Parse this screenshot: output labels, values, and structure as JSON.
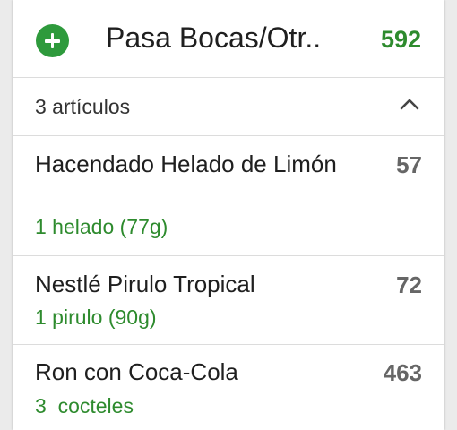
{
  "meal": {
    "title": "Pasa Bocas/Otr..",
    "total_calories": "592",
    "item_count_label": "3 artículos"
  },
  "items": [
    {
      "name": "Hacendado Helado de Limón",
      "serving": "1 helado (77g)",
      "calories": "57"
    },
    {
      "name": "Nestlé Pirulo Tropical",
      "serving": "1 pirulo (90g)",
      "calories": "72"
    },
    {
      "name": "Ron con Coca-Cola",
      "serving": "3  cocteles",
      "calories": "463"
    }
  ],
  "colors": {
    "accent_green": "#2e9a3c",
    "calorie_gray": "#666666"
  },
  "icons": {
    "add": "plus-circle-icon",
    "collapse": "chevron-up-icon"
  }
}
